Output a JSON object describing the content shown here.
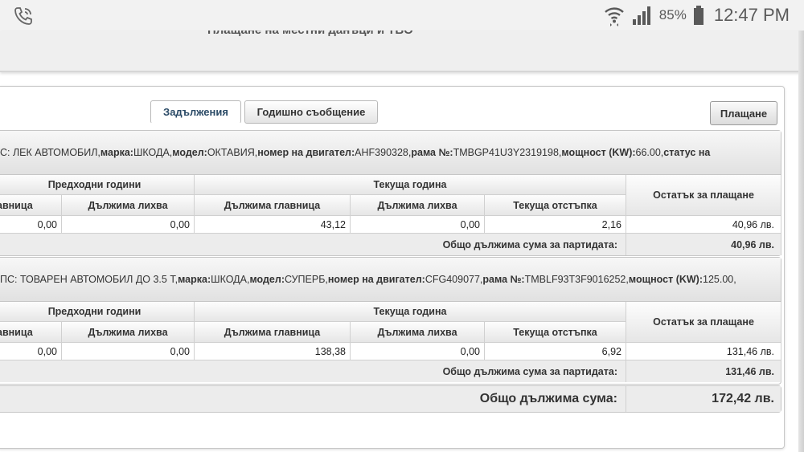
{
  "status_bar": {
    "battery_pct": "85%",
    "time": "12:47 PM",
    "icons": [
      "phone-call-icon",
      "wifi-icon",
      "signal-icon",
      "battery-icon"
    ]
  },
  "page": {
    "title": "Плащане на местни данъци и ТБО"
  },
  "tabs": [
    {
      "label": "Задължения",
      "active": true
    },
    {
      "label": "Годишно съобщение",
      "active": false
    }
  ],
  "pay_button": "Плащане",
  "headers": {
    "prev_years": "Предходни години",
    "current_year": "Текуща година",
    "principal_cut": "авница",
    "interest": "Дължима лихва",
    "principal": "Дължима главница",
    "discount": "Текуща отстъпка",
    "remaining": "Остатък за плащане"
  },
  "total_label": "Общо дължима сума за партидата:",
  "vehicles": [
    {
      "desc": [
        {
          "b": false,
          "t": "С: ЛЕК АВТОМОБИЛ, "
        },
        {
          "b": true,
          "t": "марка:"
        },
        {
          "b": false,
          "t": " ШКОДА, "
        },
        {
          "b": true,
          "t": "модел:"
        },
        {
          "b": false,
          "t": " ОКТАВИЯ, "
        },
        {
          "b": true,
          "t": "номер на двигател:"
        },
        {
          "b": false,
          "t": " AHF390328, "
        },
        {
          "b": true,
          "t": "рама №:"
        },
        {
          "b": false,
          "t": " TMBGP41U3Y2319198, "
        },
        {
          "b": true,
          "t": "мощност (KW):"
        },
        {
          "b": false,
          "t": " 66.00, "
        },
        {
          "b": true,
          "t": "статус на"
        }
      ],
      "prev_principal": "0,00",
      "prev_interest": "0,00",
      "cur_principal": "43,12",
      "cur_interest": "0,00",
      "discount": "2,16",
      "remaining": "40,96 лв.",
      "total": "40,96 лв."
    },
    {
      "desc": [
        {
          "b": false,
          "t": "ПС: ТОВАРЕН АВТОМОБИЛ ДО 3.5 Т, "
        },
        {
          "b": true,
          "t": "марка:"
        },
        {
          "b": false,
          "t": " ШКОДА, "
        },
        {
          "b": true,
          "t": "модел:"
        },
        {
          "b": false,
          "t": " СУПЕРБ, "
        },
        {
          "b": true,
          "t": "номер на двигател:"
        },
        {
          "b": false,
          "t": " CFG409077, "
        },
        {
          "b": true,
          "t": "рама №:"
        },
        {
          "b": false,
          "t": " TMBLF93T3F9016252, "
        },
        {
          "b": true,
          "t": "мощност (KW):"
        },
        {
          "b": false,
          "t": " 125.00,"
        }
      ],
      "prev_principal": "0,00",
      "prev_interest": "0,00",
      "cur_principal": "138,38",
      "cur_interest": "0,00",
      "discount": "6,92",
      "remaining": "131,46 лв.",
      "total": "131,46 лв."
    }
  ],
  "grand_total": {
    "label": "Общо дължима сума:",
    "value": "172,42 лв."
  }
}
